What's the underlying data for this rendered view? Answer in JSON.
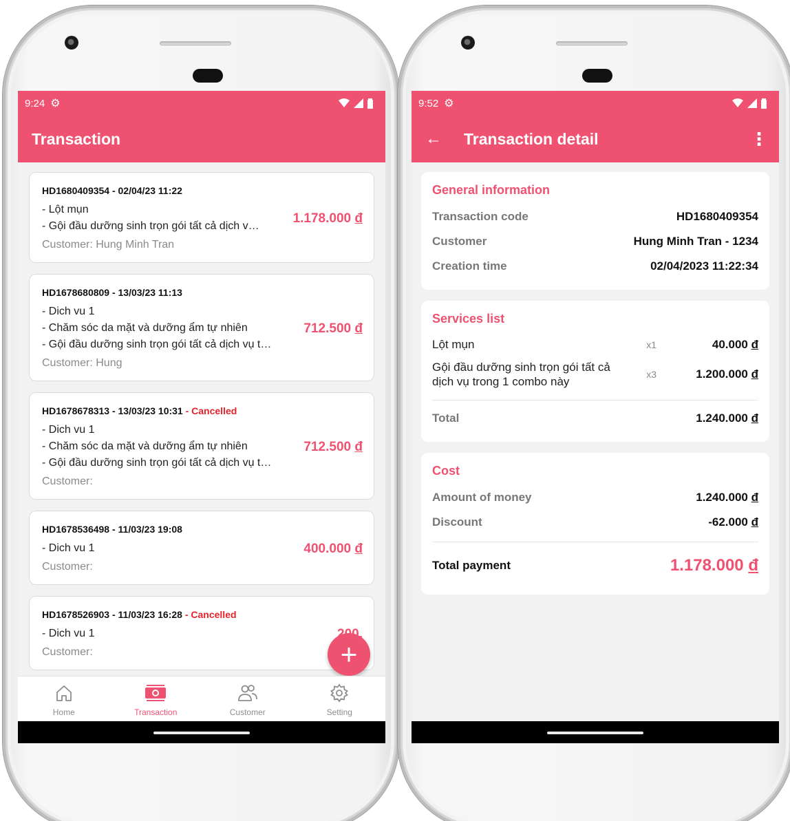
{
  "left": {
    "status": {
      "time": "9:24"
    },
    "title": "Transaction",
    "transactions": [
      {
        "head": "HD1680409354 - 02/04/23 11:22",
        "cancelled": "",
        "services": [
          "- Lột mụn",
          "- Gội đầu dưỡng sinh trọn gói tất cả dịch v…"
        ],
        "customer": "Customer: Hung Minh Tran",
        "amount": "1.178.000",
        "currency": "đ"
      },
      {
        "head": "HD1678680809 - 13/03/23 11:13",
        "cancelled": "",
        "services": [
          "- Dich vu 1",
          "- Chăm sóc da mặt và dưỡng ẩm tự nhiên",
          "- Gội đầu dưỡng sinh trọn gói tất cả dịch vụ t…"
        ],
        "customer": "Customer: Hung",
        "amount": "712.500",
        "currency": "đ"
      },
      {
        "head": "HD1678678313 - 13/03/23 10:31",
        "cancelled": " - Cancelled",
        "services": [
          "- Dich vu 1",
          "- Chăm sóc da mặt và dưỡng ẩm tự nhiên",
          "- Gội đầu dưỡng sinh trọn gói tất cả dịch vụ t…"
        ],
        "customer": "Customer:",
        "amount": "712.500",
        "currency": "đ"
      },
      {
        "head": "HD1678536498 - 11/03/23 19:08",
        "cancelled": "",
        "services": [
          "- Dich vu 1"
        ],
        "customer": "Customer:",
        "amount": "400.000",
        "currency": "đ"
      },
      {
        "head": "HD1678526903 - 11/03/23 16:28",
        "cancelled": " - Cancelled",
        "services": [
          "- Dich vu 1"
        ],
        "customer": "Customer:",
        "amount": "200.",
        "currency": ""
      }
    ],
    "fab": "+",
    "nav": [
      {
        "label": "Home",
        "icon": "home-icon",
        "active": false
      },
      {
        "label": "Transaction",
        "icon": "money-icon",
        "active": true
      },
      {
        "label": "Customer",
        "icon": "people-icon",
        "active": false
      },
      {
        "label": "Setting",
        "icon": "gear-icon",
        "active": false
      }
    ]
  },
  "right": {
    "status": {
      "time": "9:52"
    },
    "title": "Transaction detail",
    "general": {
      "title": "General information",
      "rows": [
        {
          "label": "Transaction code",
          "value": "HD1680409354"
        },
        {
          "label": "Customer",
          "value": "Hung Minh Tran - 1234"
        },
        {
          "label": "Creation time",
          "value": "02/04/2023 11:22:34"
        }
      ]
    },
    "services": {
      "title": "Services list",
      "items": [
        {
          "name": "Lột mụn",
          "qty": "x1",
          "price": "40.000",
          "currency": "đ"
        },
        {
          "name": "Gội đầu dưỡng sinh trọn gói tất cả dịch vụ trong 1 combo này",
          "qty": "x3",
          "price": "1.200.000",
          "currency": "đ"
        }
      ],
      "total_label": "Total",
      "total_value": "1.240.000",
      "currency": "đ"
    },
    "cost": {
      "title": "Cost",
      "amount_label": "Amount of money",
      "amount_value": "1.240.000",
      "discount_label": "Discount",
      "discount_value": "-62.000",
      "total_label": "Total payment",
      "total_value": "1.178.000",
      "currency": "đ"
    }
  },
  "colors": {
    "accent": "#ef5270",
    "cancelled": "#e8212b",
    "background": "#f2f2f2"
  }
}
